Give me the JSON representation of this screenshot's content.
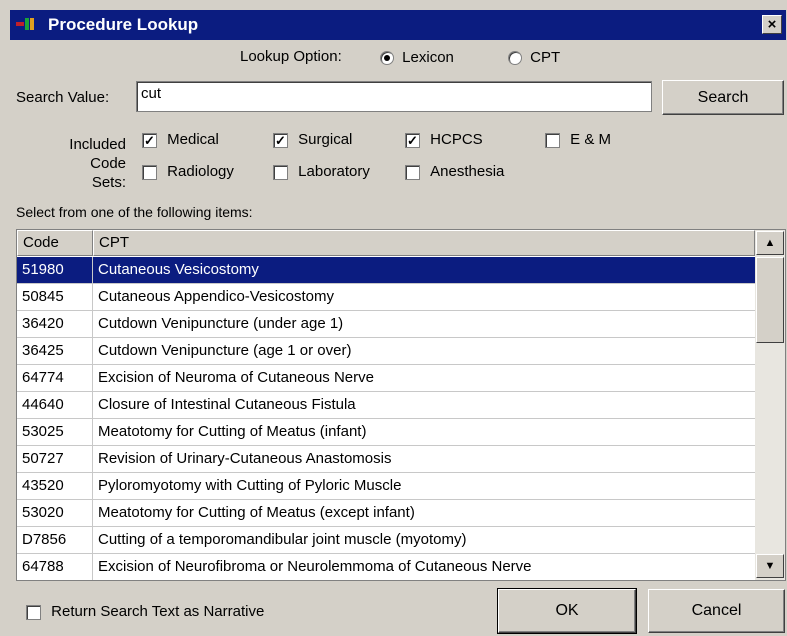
{
  "window": {
    "title": "Procedure Lookup",
    "close_glyph": "×"
  },
  "lookup_option": {
    "label": "Lookup Option:",
    "options": [
      {
        "label": "Lexicon",
        "selected": true
      },
      {
        "label": "CPT",
        "selected": false
      }
    ]
  },
  "search": {
    "label": "Search Value:",
    "value": "cut",
    "button_label": "Search"
  },
  "code_sets": {
    "label_line1": "Included",
    "label_line2": "Code Sets:",
    "items": [
      {
        "label": "Medical",
        "checked": true
      },
      {
        "label": "Surgical",
        "checked": true
      },
      {
        "label": "HCPCS",
        "checked": true
      },
      {
        "label": "E & M",
        "checked": false
      },
      {
        "label": "Radiology",
        "checked": false
      },
      {
        "label": "Laboratory",
        "checked": false
      },
      {
        "label": "Anesthesia",
        "checked": false
      }
    ]
  },
  "list": {
    "prompt": "Select from one of the following items:",
    "columns": [
      "Code",
      "CPT"
    ],
    "rows": [
      {
        "code": "51980",
        "desc": "Cutaneous Vesicostomy",
        "selected": true
      },
      {
        "code": "50845",
        "desc": "Cutaneous Appendico-Vesicostomy"
      },
      {
        "code": "36420",
        "desc": "Cutdown Venipuncture (under age 1)"
      },
      {
        "code": "36425",
        "desc": "Cutdown Venipuncture (age 1 or over)"
      },
      {
        "code": "64774",
        "desc": "Excision of Neuroma of Cutaneous Nerve"
      },
      {
        "code": "44640",
        "desc": "Closure of Intestinal Cutaneous Fistula"
      },
      {
        "code": "53025",
        "desc": "Meatotomy for Cutting of Meatus (infant)"
      },
      {
        "code": "50727",
        "desc": "Revision of Urinary-Cutaneous Anastomosis"
      },
      {
        "code": "43520",
        "desc": "Pyloromyotomy with Cutting of Pyloric Muscle"
      },
      {
        "code": "53020",
        "desc": "Meatotomy for Cutting of Meatus (except infant)"
      },
      {
        "code": "D7856",
        "desc": "Cutting of a temporomandibular joint muscle (myotomy)"
      },
      {
        "code": "64788",
        "desc": "Excision of Neurofibroma or Neurolemmoma of Cutaneous Nerve"
      }
    ]
  },
  "footer": {
    "narrative_label": "Return Search Text as Narrative",
    "narrative_checked": false,
    "ok_label": "OK",
    "cancel_label": "Cancel"
  },
  "colors": {
    "titlebar": "#0b1c80",
    "selection": "#0b1c80",
    "face": "#d4d0c8"
  }
}
